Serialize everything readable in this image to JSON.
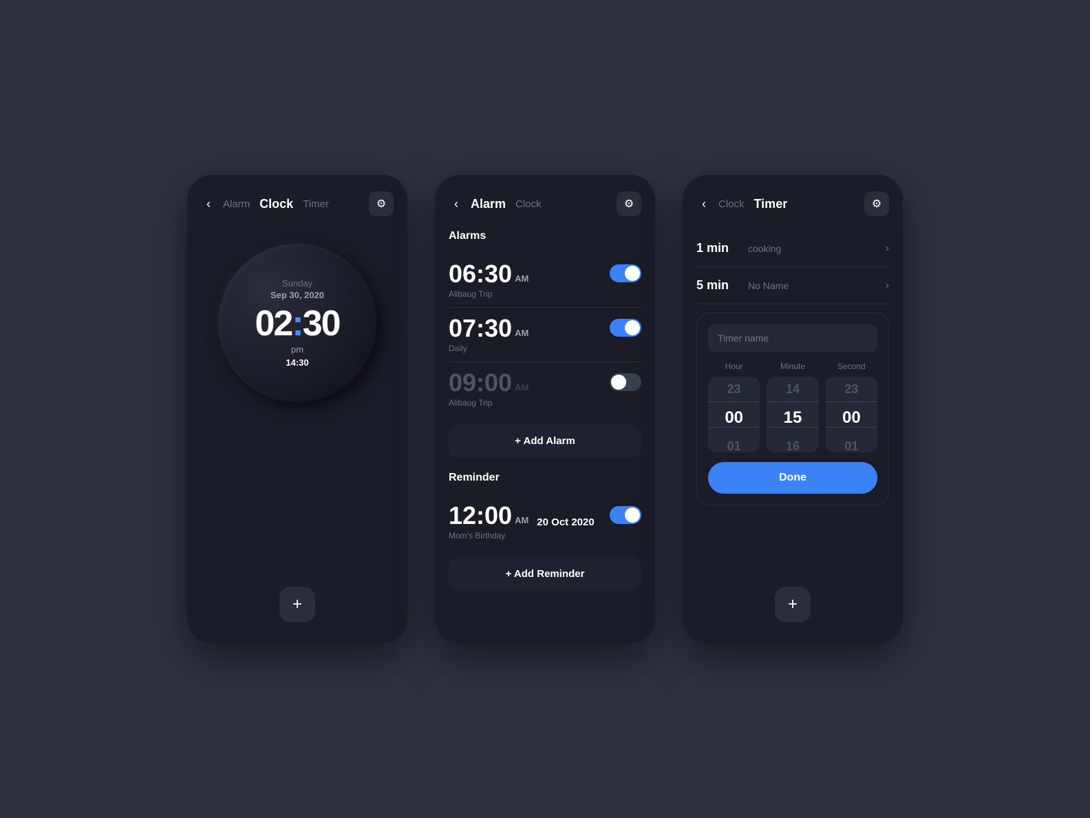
{
  "screen1": {
    "title": "Clock",
    "navTabs": [
      "Alarm",
      "Clock",
      "Timer"
    ],
    "activeTab": "Clock",
    "day": "Sunday",
    "date": "Sep 30, 2020",
    "time": "02:30",
    "ampm": "pm",
    "time24": "14:30",
    "fabIcon": "+"
  },
  "screen2": {
    "title": "Alarm",
    "navTabs": [
      "Alarm",
      "Clock"
    ],
    "activeTab": "Alarm",
    "alarmsSection": "Alarms",
    "alarms": [
      {
        "time": "06:30",
        "ampm": "AM",
        "label": "Alibaug Trip",
        "enabled": true
      },
      {
        "time": "07:30",
        "ampm": "AM",
        "label": "Daily",
        "enabled": true
      },
      {
        "time": "09:00",
        "ampm": "AM",
        "label": "Alibaug Trip",
        "enabled": false
      }
    ],
    "addAlarmLabel": "+ Add Alarm",
    "reminderSection": "Reminder",
    "reminders": [
      {
        "time": "12:00",
        "ampm": "AM",
        "date": "20 Oct 2020",
        "label": "Mom's Birthday",
        "enabled": true
      }
    ],
    "addReminderLabel": "+ Add Reminder"
  },
  "screen3": {
    "title": "Timer",
    "navTabs": [
      "Clock",
      "Timer"
    ],
    "activeTab": "Timer",
    "presets": [
      {
        "duration": "1 min",
        "name": "cooking"
      },
      {
        "duration": "5 min",
        "name": "No Name"
      }
    ],
    "picker": {
      "placeholder": "Timer name",
      "hourLabel": "Hour",
      "minuteLabel": "Minute",
      "secondLabel": "Second",
      "hourValues": [
        "23",
        "00",
        "01"
      ],
      "minuteValues": [
        "14",
        "15",
        "16"
      ],
      "secondValues": [
        "23",
        "00",
        "01"
      ],
      "selectedHour": "00",
      "selectedMinute": "15",
      "selectedSecond": "00"
    },
    "doneLabel": "Done",
    "fabIcon": "+"
  },
  "icons": {
    "back": "‹",
    "settings": "⚙",
    "chevronRight": "›",
    "plus": "+"
  }
}
